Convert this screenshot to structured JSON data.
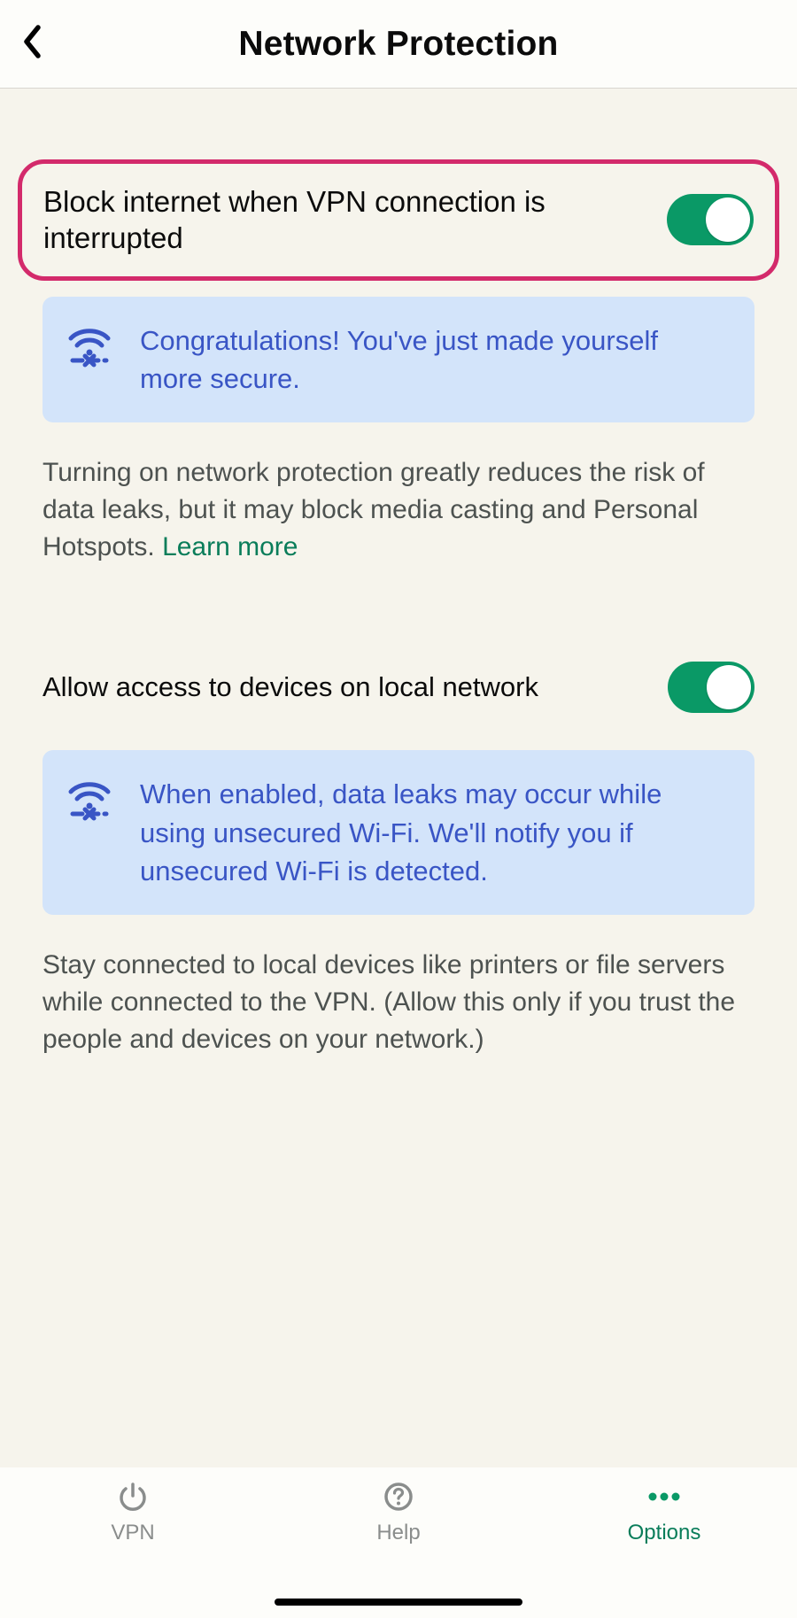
{
  "header": {
    "title": "Network Protection"
  },
  "settings": {
    "blockInternet": {
      "label": "Block internet when VPN connection is interrupted",
      "enabled": true,
      "callout": "Congratulations! You've just made yourself more secure.",
      "description": "Turning on network protection greatly reduces the risk of data leaks, but it may block media casting and Personal Hotspots. ",
      "learnMoreLabel": "Learn more"
    },
    "localNetwork": {
      "label": "Allow access to devices on local network",
      "enabled": true,
      "callout": "When enabled, data leaks may occur while using unsecured Wi-Fi. We'll notify you if unsecured Wi-Fi is detected.",
      "description": "Stay connected to local devices like printers or file servers while connected to the VPN. (Allow this only if you trust the people and devices on your network.)"
    }
  },
  "tabs": {
    "vpn": {
      "label": "VPN"
    },
    "help": {
      "label": "Help"
    },
    "options": {
      "label": "Options"
    }
  },
  "colors": {
    "accent": "#0a9966",
    "highlight": "#d32a6b",
    "link": "#0a7d5a",
    "calloutBg": "#d3e4fa",
    "calloutText": "#3955c5"
  }
}
